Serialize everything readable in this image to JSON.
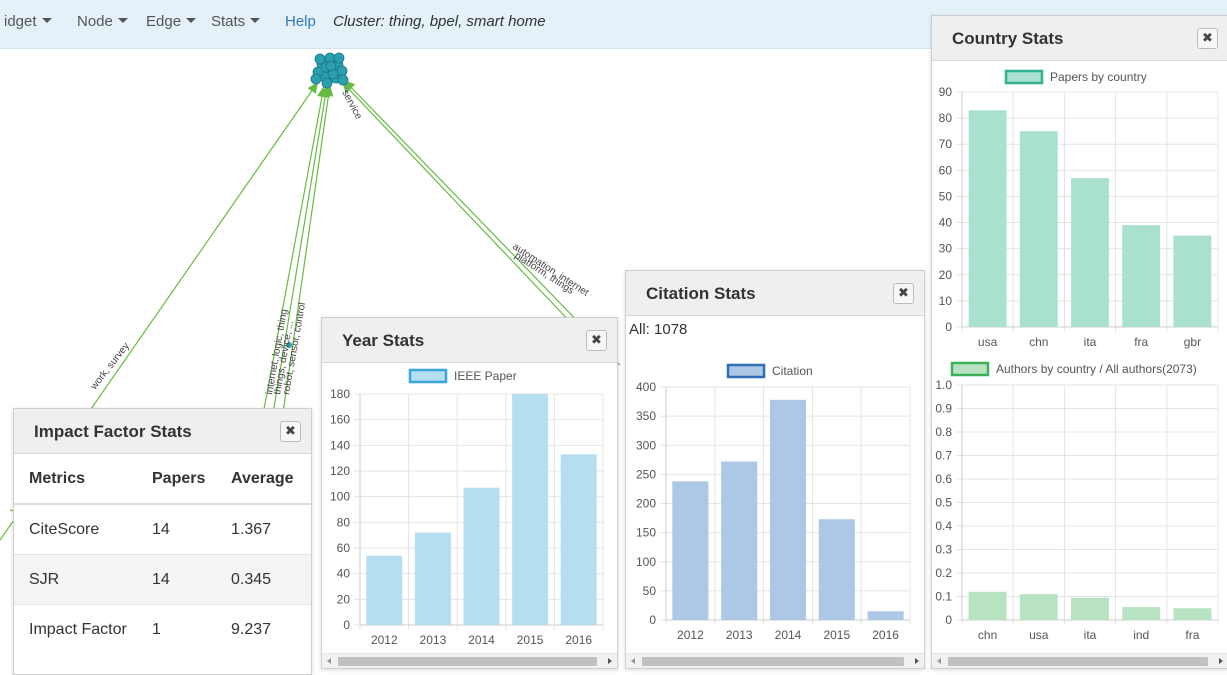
{
  "nav": {
    "items": [
      {
        "label": "idget",
        "has_caret": true
      },
      {
        "label": "Node",
        "has_caret": true
      },
      {
        "label": "Edge",
        "has_caret": true
      },
      {
        "label": "Stats",
        "has_caret": true
      }
    ],
    "help": "Help",
    "cluster": "Cluster: thing, bpel, smart home"
  },
  "network": {
    "edge_labels": [
      "work, survey",
      "internet, logic, thing",
      "things, device, ...",
      "robot, sensor, control",
      "service",
      "automation, internet",
      "platform, things"
    ],
    "edge_color": "#66bb44",
    "node_color": "#2a9fb0"
  },
  "panels": {
    "impact": {
      "title": "Impact Factor Stats",
      "close": "✖",
      "headers": [
        "Metrics",
        "Papers",
        "Average"
      ],
      "rows": [
        [
          "CiteScore",
          "14",
          "1.367"
        ],
        [
          "SJR",
          "14",
          "0.345"
        ],
        [
          "Impact Factor",
          "1",
          "9.237"
        ]
      ]
    },
    "year": {
      "title": "Year Stats",
      "close": "✖"
    },
    "citation": {
      "title": "Citation Stats",
      "close": "✖",
      "all": "All: 1078"
    },
    "country": {
      "title": "Country Stats",
      "close": "✖"
    }
  },
  "chart_data": [
    {
      "id": "year",
      "type": "bar",
      "legend": "IEEE Paper",
      "categories": [
        "2012",
        "2013",
        "2014",
        "2015",
        "2016"
      ],
      "values": [
        54,
        72,
        107,
        180,
        133
      ],
      "ylim": [
        0,
        180
      ],
      "yticks": [
        0,
        20,
        40,
        60,
        80,
        100,
        120,
        140,
        160,
        180
      ],
      "fill": "#b5def0",
      "stroke": "#3aa6d8",
      "grid": true
    },
    {
      "id": "citation",
      "type": "bar",
      "legend": "Citation",
      "categories": [
        "2012",
        "2013",
        "2014",
        "2015",
        "2016"
      ],
      "values": [
        238,
        272,
        378,
        173,
        15
      ],
      "ylim": [
        0,
        400
      ],
      "yticks": [
        0,
        50,
        100,
        150,
        200,
        250,
        300,
        350,
        400
      ],
      "fill": "#adc8e6",
      "stroke": "#2f6db5",
      "grid": true
    },
    {
      "id": "country-papers",
      "type": "bar",
      "legend": "Papers by country",
      "categories": [
        "usa",
        "chn",
        "ita",
        "fra",
        "gbr"
      ],
      "values": [
        83,
        75,
        57,
        39,
        35
      ],
      "ylim": [
        0,
        90
      ],
      "yticks": [
        0,
        10,
        20,
        30,
        40,
        50,
        60,
        70,
        80,
        90
      ],
      "fill": "#a9e0d0",
      "stroke": "#2fb48f",
      "grid": true
    },
    {
      "id": "country-authors",
      "type": "bar",
      "legend": "Authors by country / All authors(2073)",
      "categories": [
        "chn",
        "usa",
        "ita",
        "ind",
        "fra"
      ],
      "values": [
        0.12,
        0.11,
        0.095,
        0.055,
        0.05
      ],
      "ylim": [
        0,
        1.0
      ],
      "yticks": [
        "0",
        "0.1",
        "0.2",
        "0.3",
        "0.4",
        "0.5",
        "0.6",
        "0.7",
        "0.8",
        "0.9",
        "1.0"
      ],
      "fill": "#b8e3c2",
      "stroke": "#3cb15a",
      "grid": true
    }
  ]
}
